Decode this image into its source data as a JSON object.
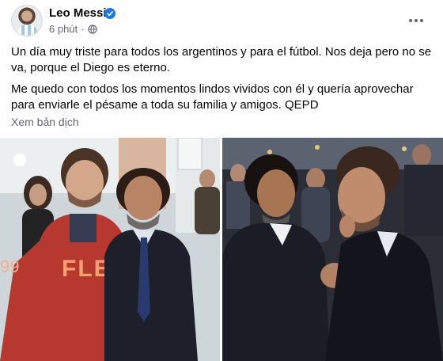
{
  "post": {
    "author": "Leo Messi",
    "timestamp": "6 phút",
    "privacy_icon": "globe-icon",
    "verified_icon": "verified-badge-icon",
    "more_icon": "more-options-icon",
    "paragraphs": [
      "Un día muy triste para todos los argentinos y para el fútbol. Nos deja pero no se va, porque el Diego es eterno.",
      "Me quedo con todos los momentos lindos vividos con él y quería aprovechar para enviarle el pésame a toda su familia y amigos. QEPD"
    ],
    "translate_label": "Xem bản dịch",
    "photo_left_jersey": "FLE",
    "photo_left_number": "99"
  },
  "colors": {
    "text": "#050505",
    "secondary": "#65676b",
    "verified": "#1877f2"
  }
}
